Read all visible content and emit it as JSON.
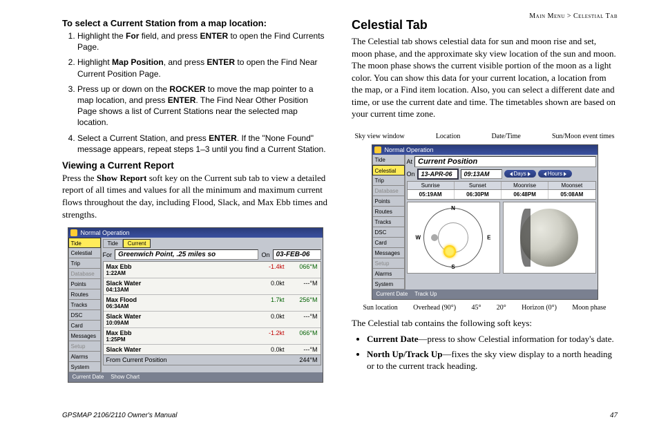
{
  "header": {
    "breadcrumb": "Main Menu > Celestial Tab"
  },
  "left": {
    "lead": "To select a Current Station from a map location:",
    "steps": [
      "Highlight the <b>For</b> field, and press <b>ENTER</b> to open the Find Currents Page.",
      "Highlight <b>Map Position</b>, and press <b>ENTER</b> to open the Find Near Current Position Page.",
      "Press up or down on the <b>ROCKER</b> to move the map pointer to a map location, and press <b>ENTER</b>. The Find Near Other Position Page shows a list of Current Stations near the selected map location.",
      "Select a Current Station, and press <b>ENTER</b>. If the \"None Found\" message appears, repeat steps 1–3 until you find a Current Station."
    ],
    "subhead": "Viewing a Current Report",
    "subpara": "Press the <b>Show Report</b> soft key on the Current sub tab to view a detailed report of all times and values for all the minimum and maximum current flows throughout the day, including Flood, Slack, and Max Ebb times and strengths."
  },
  "device1": {
    "title": "Normal Operation",
    "side": [
      "Tide",
      "Celestial",
      "Trip",
      "Database",
      "Points",
      "Routes",
      "Tracks",
      "DSC",
      "Card",
      "Messages",
      "Setup",
      "Alarms",
      "System"
    ],
    "side_selected": "Tide",
    "side_dim": [
      "Database",
      "Setup"
    ],
    "subtabs": [
      "Tide",
      "Current"
    ],
    "subtab_selected": "Current",
    "for_label": "For",
    "for_value": "Greenwich Point, .25 miles so",
    "on_label": "On",
    "on_value": "03-FEB-06",
    "rows": [
      {
        "label": "Max Ebb",
        "time": "1:22AM",
        "v1": "-1.4kt",
        "c1": "neg",
        "v2": "066°M",
        "c2": "pos"
      },
      {
        "label": "Slack Water",
        "time": "04:13AM",
        "v1": "0.0kt",
        "c1": "",
        "v2": "---°M",
        "c2": ""
      },
      {
        "label": "Max Flood",
        "time": "06:34AM",
        "v1": "1.7kt",
        "c1": "pos",
        "v2": "256°M",
        "c2": "pos"
      },
      {
        "label": "Slack Water",
        "time": "10:09AM",
        "v1": "0.0kt",
        "c1": "",
        "v2": "---°M",
        "c2": ""
      },
      {
        "label": "Max Ebb",
        "time": "1:25PM",
        "v1": "-1.2kt",
        "c1": "neg",
        "v2": "066°M",
        "c2": "pos"
      },
      {
        "label": "Slack Water",
        "time": "",
        "v1": "0.0kt",
        "c1": "",
        "v2": "---°M",
        "c2": ""
      }
    ],
    "from_label": "From Current Position",
    "from_value": "244°M",
    "footer": [
      "Current Date",
      "Show Chart"
    ]
  },
  "right": {
    "h": "Celestial Tab",
    "para": "The Celestial tab shows celestial data for sun and moon rise and set, moon phase, and the approximate sky view location of the sun and moon. The moon phase shows the current visible portion of the moon as a light color. You can show this data for your current location, a location from the map, or a Find item location. Also, you can select a different date and time, or use the current date and time. The timetables shown are based on your current time zone.",
    "intro2": "The Celestial tab contains the following soft keys:",
    "bullets": [
      "<b>Current Date</b>—press to show Celestial information for today's date.",
      "<b>North Up/Track Up</b>—fixes the sky view display to a north heading or to the current track heading."
    ]
  },
  "callouts_top": [
    "Sky view window",
    "Location",
    "Date/Time",
    "Sun/Moon event times"
  ],
  "callouts_bot": [
    "Sun location",
    "Overhead (90°)",
    "45°",
    "20°",
    "Horizon (0°)",
    "Moon phase"
  ],
  "device2": {
    "title": "Normal Operation",
    "side": [
      "Tide",
      "Celestial",
      "Trip",
      "Database",
      "Points",
      "Routes",
      "Tracks",
      "DSC",
      "Card",
      "Messages",
      "Setup",
      "Alarms",
      "System"
    ],
    "side_selected": "Celestial",
    "side_dim": [
      "Database",
      "Setup"
    ],
    "at_label": "At",
    "at_value": "Current Position",
    "on_label": "On",
    "date": "13-APR-06",
    "time": "09:13AM",
    "days_btn": "Days",
    "hours_btn": "Hours",
    "head": [
      "Sunrise",
      "Sunset",
      "Moonrise",
      "Moonset"
    ],
    "vals": [
      "05:19AM",
      "06:30PM",
      "06:48PM",
      "05:08AM"
    ],
    "footer": [
      "Current Date",
      "Track Up"
    ]
  },
  "footer": {
    "left": "GPSMAP 2106/2110 Owner's Manual",
    "right": "47"
  }
}
